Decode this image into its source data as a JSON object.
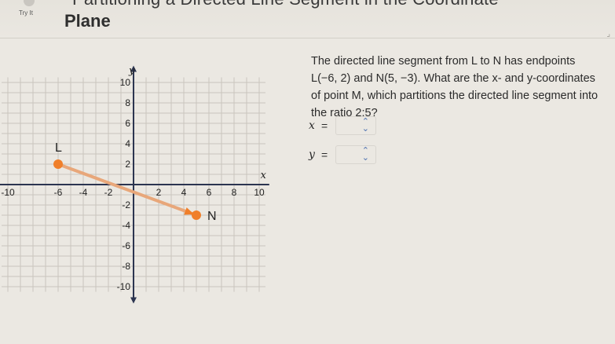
{
  "header": {
    "title_top": "Partitioning a Directed Line Segment in the Coordinate",
    "title_main": "Plane",
    "try_label": "Try It"
  },
  "graph": {
    "y_label": "y",
    "x_label": "x",
    "x_range": [
      -10,
      10
    ],
    "y_range": [
      -10,
      10
    ],
    "x_ticks": [
      "-10",
      "-6",
      "-4",
      "-2",
      "2",
      "4",
      "6",
      "8",
      "10"
    ],
    "y_ticks": [
      "10",
      "8",
      "6",
      "4",
      "2",
      "-2",
      "-4",
      "-6",
      "-8",
      "-10"
    ],
    "point_L": {
      "label": "L",
      "x": -6,
      "y": 2
    },
    "point_N": {
      "label": "N",
      "x": 5,
      "y": -3
    },
    "segment_color": "#e8a77a",
    "point_color": "#f07f2a"
  },
  "question": {
    "text": "The directed line segment from L to N has endpoints L(−6, 2) and N(5, −3). What are the x- and y-coordinates of point M, which partitions the directed line segment into the ratio 2:5?"
  },
  "answers": {
    "x_var": "x",
    "y_var": "y",
    "eq": "=",
    "spinner_icon": "⌃⌄"
  }
}
